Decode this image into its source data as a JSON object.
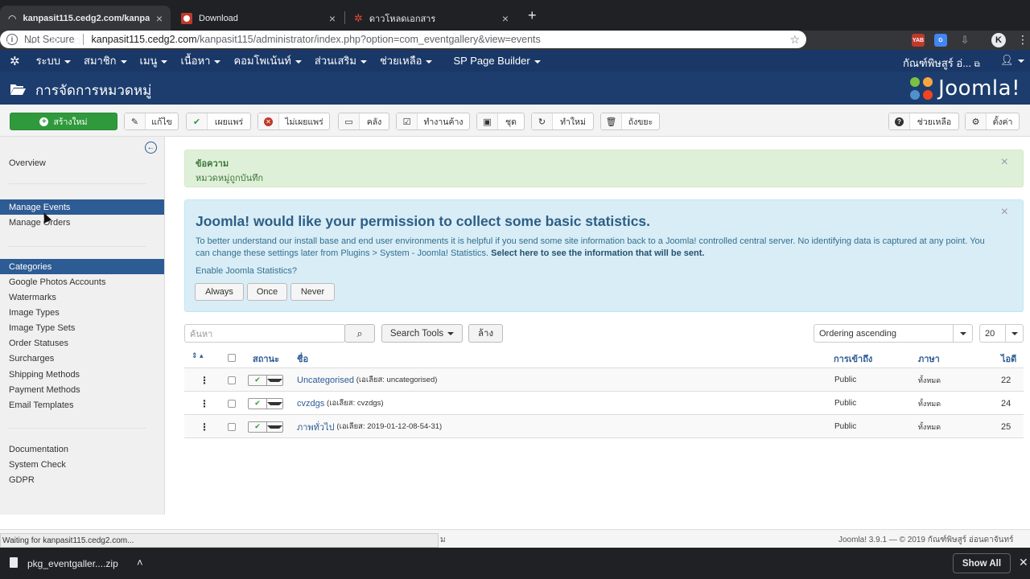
{
  "browser": {
    "tabs": [
      {
        "title": "kanpasit115.cedg2.com/kanpa",
        "close": "×"
      },
      {
        "title": "Download",
        "close": "×"
      },
      {
        "title": "ดาวโหลดเอกสาร",
        "close": "×"
      }
    ],
    "new_tab": "+",
    "not_secure": "Not Secure",
    "url_host": "kanpasit115.cedg2.com",
    "url_path": "/kanpasit115/administrator/index.php?option=com_eventgallery&view=events",
    "ext_yab": "YAB"
  },
  "topmenu": {
    "items": [
      "ระบบ",
      "สมาชิก",
      "เมนู",
      "เนื้อหา",
      "คอมโพเน้นท์",
      "ส่วนเสริม",
      "ช่วยเหลือ",
      "SP Page Builder"
    ],
    "user": "กัณฑ์พิษสูร์ อ่..."
  },
  "header": {
    "title": "การจัดการหมวดหมู่",
    "logo": "Joomla!"
  },
  "toolbar": {
    "new": "สร้างใหม่",
    "edit": "แก้ไข",
    "publish": "เผยแพร่",
    "unpublish": "ไม่เผยแพร่",
    "archive": "คลัง",
    "checkin": "ทำงานค้าง",
    "batch": "ชุด",
    "rebuild": "ทำใหม่",
    "trash": "ถังขยะ",
    "help": "ช่วยเหลือ",
    "options": "ตั้งค่า"
  },
  "sidebar": {
    "overview": "Overview",
    "manage_events": "Manage Events",
    "manage_orders": "Manage Orders",
    "items": [
      "Categories",
      "Google Photos Accounts",
      "Watermarks",
      "Image Types",
      "Image Type Sets",
      "Order Statuses",
      "Surcharges",
      "Shipping Methods",
      "Payment Methods",
      "Email Templates"
    ],
    "bottom": [
      "Documentation",
      "System Check",
      "GDPR"
    ]
  },
  "message": {
    "heading": "ข้อความ",
    "text": "หมวดหมู่ถูกบันทึก"
  },
  "stats": {
    "title": "Joomla! would like your permission to collect some basic statistics.",
    "body": "To better understand our install base and end user environments it is helpful if you send some site information back to a Joomla! controlled central server. No identifying data is captured at any point. You can change these settings later from Plugins > System - Joomla! Statistics.",
    "link": "Select here to see the information that will be sent.",
    "question": "Enable Joomla Statistics?",
    "always": "Always",
    "once": "Once",
    "never": "Never"
  },
  "filters": {
    "search_placeholder": "ค้นหา",
    "search_tools": "Search Tools",
    "clear": "ล้าง",
    "ordering": "Ordering ascending",
    "limit": "20"
  },
  "table": {
    "headers": {
      "status": "สถานะ",
      "title": "ชื่อ",
      "access": "การเข้าถึง",
      "language": "ภาษา",
      "id": "ไอดี"
    },
    "rows": [
      {
        "title": "Uncategorised",
        "alias": "(เอเลียส: uncategorised)",
        "access": "Public",
        "language": "ทั้งหมด",
        "id": "22"
      },
      {
        "title": "cvzdgs",
        "alias": "(เอเลียส: cvzdgs)",
        "access": "Public",
        "language": "ทั้งหมด",
        "id": "24"
      },
      {
        "title": "ภาพทั่วไป",
        "alias": "(เอเลียส: 2019-01-12-08-54-31)",
        "access": "Public",
        "language": "ทั้งหมด",
        "id": "25"
      }
    ]
  },
  "statusbar": {
    "waiting": "Waiting for kanpasit115.cedg2.com...",
    "left_fragment": "ม",
    "footer": "Joomla! 3.9.1  —  © 2019 กัณฑ์พิษสูร์ อ่อนดาจันทร์"
  },
  "download": {
    "file": "pkg_eventgaller....zip",
    "show_all": "Show All"
  }
}
